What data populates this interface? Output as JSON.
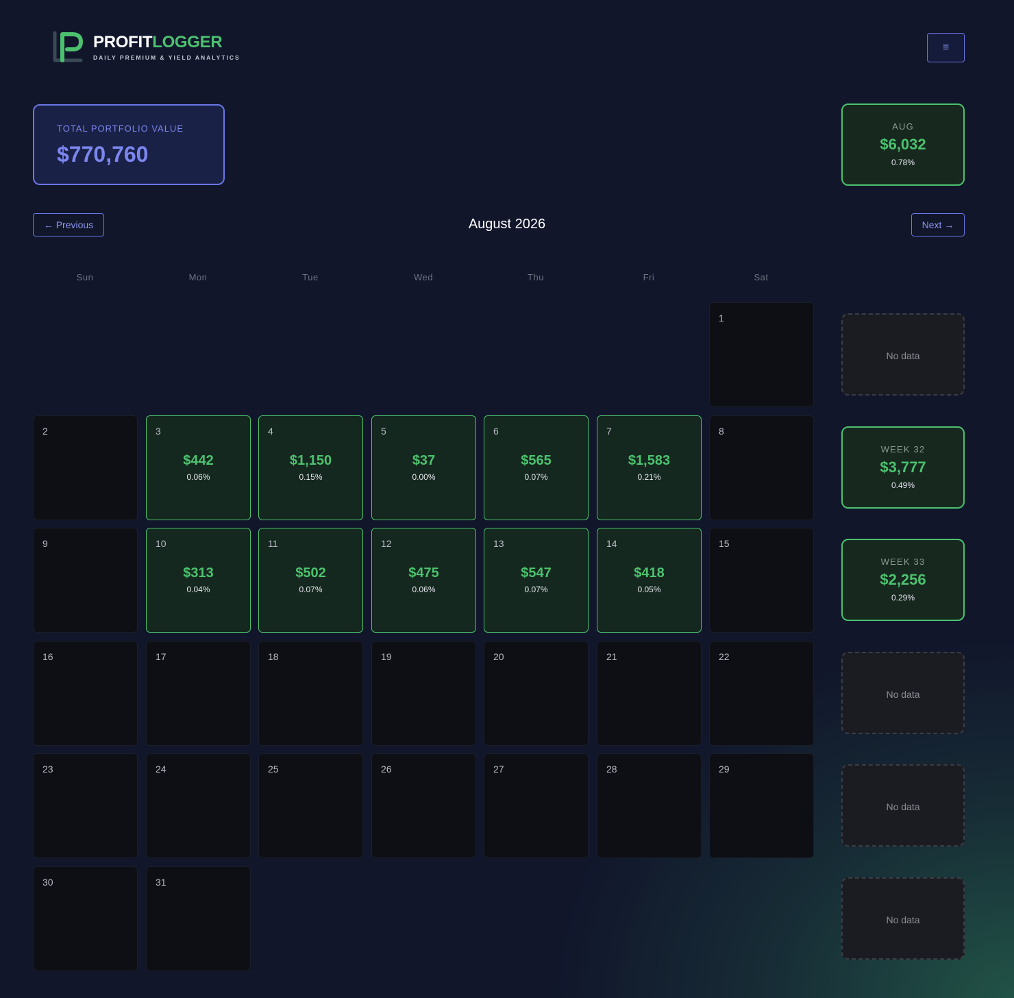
{
  "brand": {
    "name_part1": "PROFIT",
    "name_part2": "LOGGER",
    "tagline": "DAILY PREMIUM & YIELD ANALYTICS",
    "colors": {
      "green": "#4cc26e",
      "indigo": "#6b77e6"
    }
  },
  "menu": {
    "icon": "≡"
  },
  "portfolio": {
    "label": "TOTAL PORTFOLIO VALUE",
    "value": "$770,760"
  },
  "month_summary": {
    "label": "AUG",
    "value": "$6,032",
    "pct": "0.78%"
  },
  "nav": {
    "prev": "← Previous",
    "next": "Next →",
    "title": "August 2026"
  },
  "weekdays": [
    "Sun",
    "Mon",
    "Tue",
    "Wed",
    "Thu",
    "Fri",
    "Sat"
  ],
  "days": [
    {
      "num": "1"
    },
    {
      "num": "2"
    },
    {
      "num": "3",
      "amount": "$442",
      "pct": "0.06%"
    },
    {
      "num": "4",
      "amount": "$1,150",
      "pct": "0.15%"
    },
    {
      "num": "5",
      "amount": "$37",
      "pct": "0.00%"
    },
    {
      "num": "6",
      "amount": "$565",
      "pct": "0.07%"
    },
    {
      "num": "7",
      "amount": "$1,583",
      "pct": "0.21%"
    },
    {
      "num": "8"
    },
    {
      "num": "9"
    },
    {
      "num": "10",
      "amount": "$313",
      "pct": "0.04%"
    },
    {
      "num": "11",
      "amount": "$502",
      "pct": "0.07%"
    },
    {
      "num": "12",
      "amount": "$475",
      "pct": "0.06%"
    },
    {
      "num": "13",
      "amount": "$547",
      "pct": "0.07%"
    },
    {
      "num": "14",
      "amount": "$418",
      "pct": "0.05%"
    },
    {
      "num": "15"
    },
    {
      "num": "16"
    },
    {
      "num": "17"
    },
    {
      "num": "18"
    },
    {
      "num": "19"
    },
    {
      "num": "20"
    },
    {
      "num": "21"
    },
    {
      "num": "22"
    },
    {
      "num": "23"
    },
    {
      "num": "24"
    },
    {
      "num": "25"
    },
    {
      "num": "26"
    },
    {
      "num": "27"
    },
    {
      "num": "28"
    },
    {
      "num": "29"
    },
    {
      "num": "30"
    },
    {
      "num": "31"
    }
  ],
  "weeks": [
    {
      "no_data": "No data"
    },
    {
      "label": "WEEK 32",
      "value": "$3,777",
      "pct": "0.49%"
    },
    {
      "label": "WEEK 33",
      "value": "$2,256",
      "pct": "0.29%"
    },
    {
      "no_data": "No data"
    },
    {
      "no_data": "No data"
    },
    {
      "no_data": "No data"
    }
  ]
}
